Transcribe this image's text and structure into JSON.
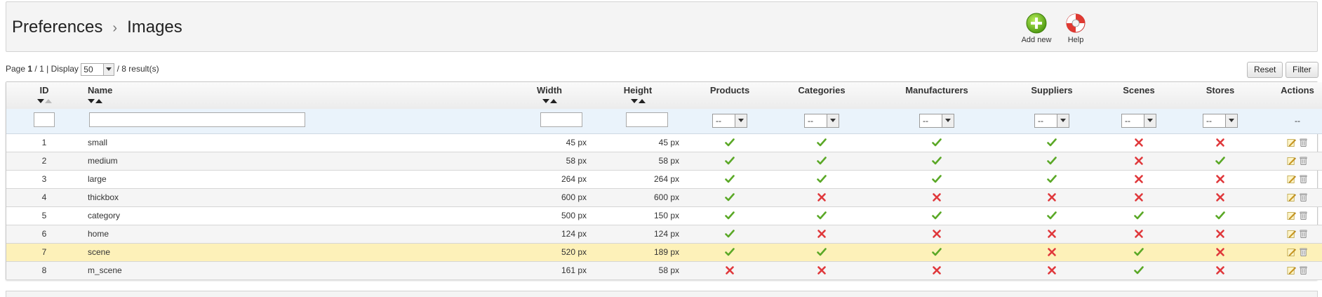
{
  "breadcrumb": {
    "parent": "Preferences",
    "separator": "›",
    "current": "Images"
  },
  "toolbar": {
    "add_new_label": "Add new",
    "help_label": "Help"
  },
  "pager": {
    "page_word": "Page",
    "page_current": "1",
    "page_total": "1",
    "display_word": "Display",
    "per_page": "50",
    "results": "8 result(s)"
  },
  "actions": {
    "reset_label": "Reset",
    "filter_label": "Filter"
  },
  "columns": {
    "id": "ID",
    "name": "Name",
    "width": "Width",
    "height": "Height",
    "products": "Products",
    "categories": "Categories",
    "manufacturers": "Manufacturers",
    "suppliers": "Suppliers",
    "scenes": "Scenes",
    "stores": "Stores",
    "actions": "Actions"
  },
  "filters": {
    "select_default": "--",
    "actions_placeholder": "--"
  },
  "rows": [
    {
      "id": "1",
      "name": "small",
      "width": "45 px",
      "height": "45 px",
      "products": true,
      "categories": true,
      "manufacturers": true,
      "suppliers": true,
      "scenes": false,
      "stores": false
    },
    {
      "id": "2",
      "name": "medium",
      "width": "58 px",
      "height": "58 px",
      "products": true,
      "categories": true,
      "manufacturers": true,
      "suppliers": true,
      "scenes": false,
      "stores": true
    },
    {
      "id": "3",
      "name": "large",
      "width": "264 px",
      "height": "264 px",
      "products": true,
      "categories": true,
      "manufacturers": true,
      "suppliers": true,
      "scenes": false,
      "stores": false
    },
    {
      "id": "4",
      "name": "thickbox",
      "width": "600 px",
      "height": "600 px",
      "products": true,
      "categories": false,
      "manufacturers": false,
      "suppliers": false,
      "scenes": false,
      "stores": false
    },
    {
      "id": "5",
      "name": "category",
      "width": "500 px",
      "height": "150 px",
      "products": true,
      "categories": true,
      "manufacturers": true,
      "suppliers": true,
      "scenes": true,
      "stores": true
    },
    {
      "id": "6",
      "name": "home",
      "width": "124 px",
      "height": "124 px",
      "products": true,
      "categories": false,
      "manufacturers": false,
      "suppliers": false,
      "scenes": false,
      "stores": false
    },
    {
      "id": "7",
      "name": "scene",
      "width": "520 px",
      "height": "189 px",
      "products": true,
      "categories": true,
      "manufacturers": true,
      "suppliers": false,
      "scenes": true,
      "stores": false
    },
    {
      "id": "8",
      "name": "m_scene",
      "width": "161 px",
      "height": "58 px",
      "products": false,
      "categories": false,
      "manufacturers": false,
      "suppliers": false,
      "scenes": true,
      "stores": false
    }
  ],
  "highlighted_row_id": "7",
  "icons": {
    "add": "plus-circle-icon",
    "help": "lifebuoy-icon",
    "yes": "green-check-icon",
    "no": "red-cross-icon",
    "edit": "pencil-icon",
    "delete": "trash-icon"
  },
  "colors": {
    "check": "#5aa826",
    "cross": "#e0383b",
    "highlight": "#fdf1b9",
    "add_green": "#6cbc1e"
  }
}
